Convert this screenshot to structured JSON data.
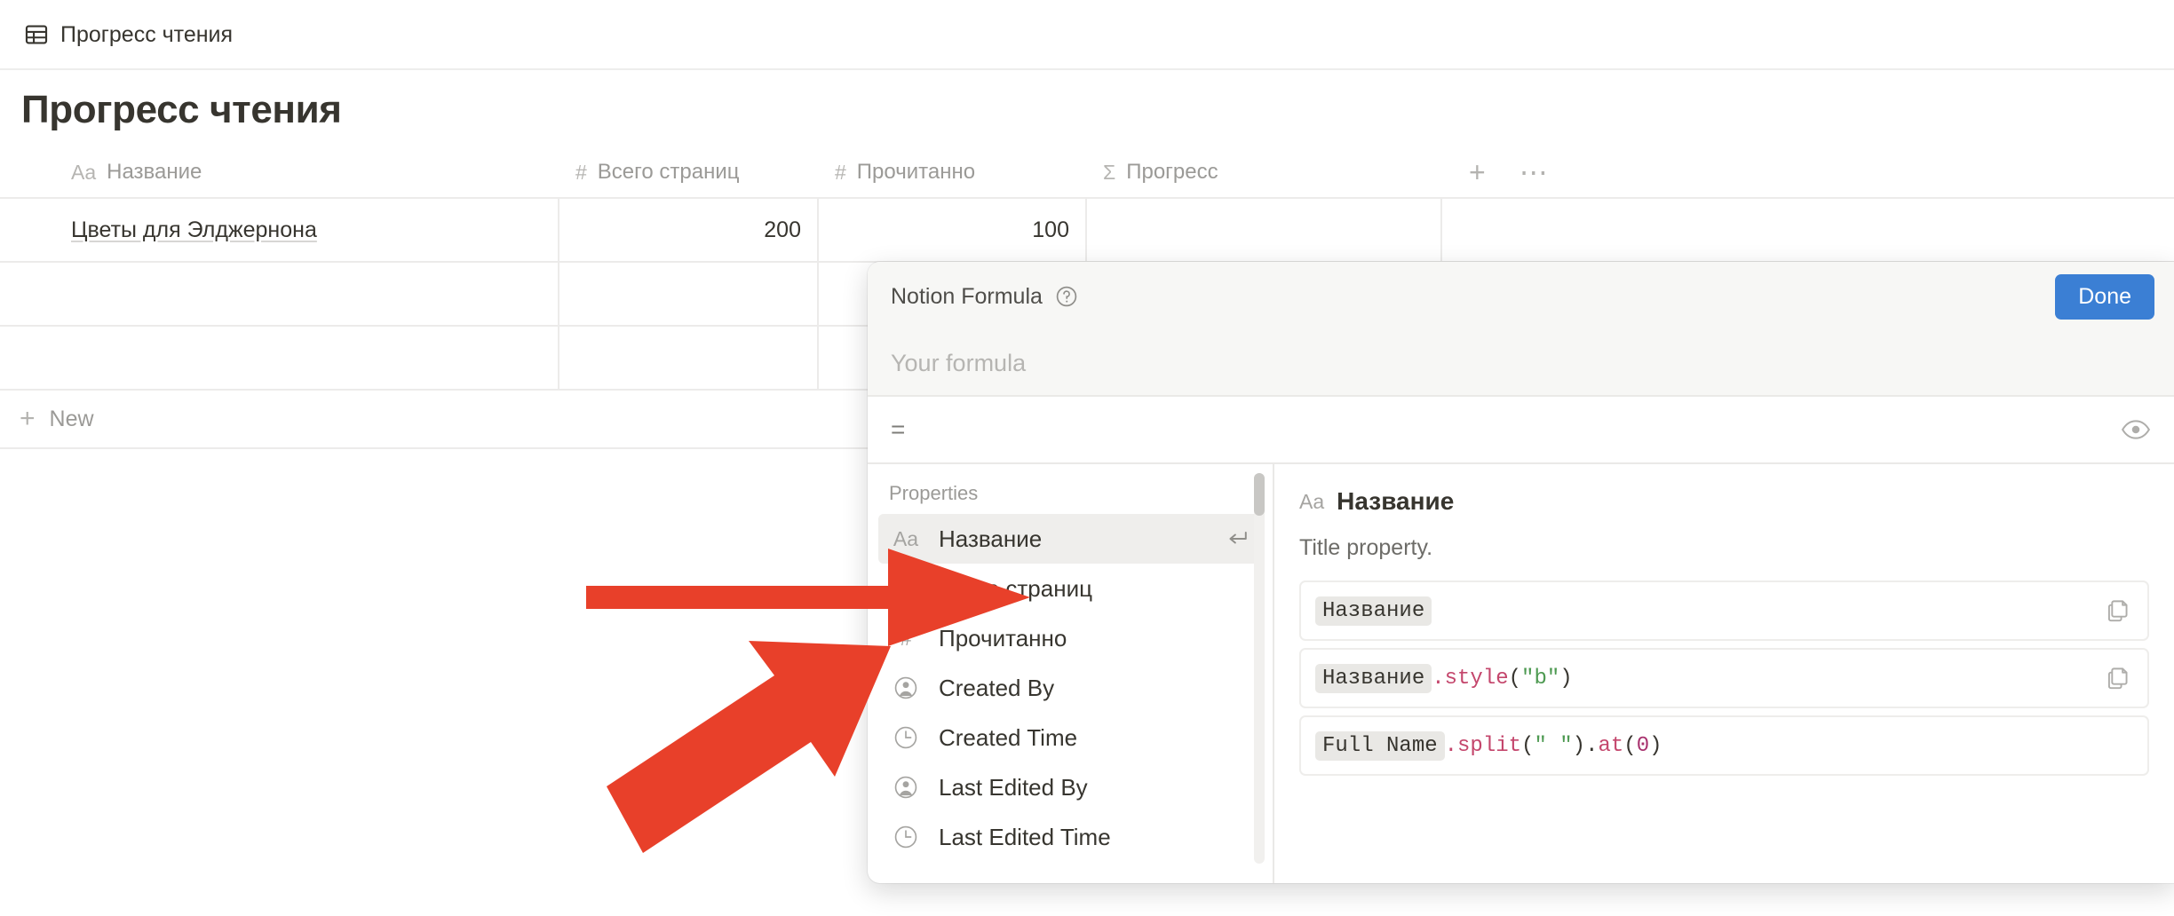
{
  "breadcrumb": {
    "icon": "table-grid-icon",
    "label": "Прогресс чтения"
  },
  "page": {
    "title": "Прогресс чтения"
  },
  "table": {
    "columns": [
      {
        "type_icon": "Aa",
        "label": "Название"
      },
      {
        "type_icon": "#",
        "label": "Всего страниц"
      },
      {
        "type_icon": "#",
        "label": "Прочитанно"
      },
      {
        "type_icon": "Σ",
        "label": "Прогресс"
      }
    ],
    "add_column_label": "+",
    "more_label": "⋯",
    "rows": [
      {
        "name": "Цветы для Элджернона",
        "total": "200",
        "read": "100",
        "progress": ""
      },
      {
        "name": "",
        "total": "",
        "read": "",
        "progress": ""
      },
      {
        "name": "",
        "total": "",
        "read": "",
        "progress": ""
      }
    ],
    "new_row_label": "New"
  },
  "dialog": {
    "title": "Notion Formula",
    "help_icon": "question-circle-icon",
    "done_label": "Done",
    "formula_placeholder": "Your formula",
    "formula_value": "",
    "equals_sign": "=",
    "preview_icon": "eye-icon",
    "properties_label": "Properties",
    "properties": [
      {
        "icon": "title-icon",
        "icon_glyph": "Aa",
        "label": "Название",
        "selected": true,
        "shortcut_icon": "return-icon"
      },
      {
        "icon": "number-icon",
        "icon_glyph": "#",
        "label": "Всего страниц",
        "selected": false
      },
      {
        "icon": "number-icon",
        "icon_glyph": "#",
        "label": "Прочитанно",
        "selected": false
      },
      {
        "icon": "person-icon",
        "icon_glyph": "",
        "label": "Created By",
        "selected": false
      },
      {
        "icon": "clock-icon",
        "icon_glyph": "",
        "label": "Created Time",
        "selected": false
      },
      {
        "icon": "person-icon",
        "icon_glyph": "",
        "label": "Last Edited By",
        "selected": false
      },
      {
        "icon": "clock-icon",
        "icon_glyph": "",
        "label": "Last Edited Time",
        "selected": false
      }
    ],
    "detail": {
      "type_glyph": "Aa",
      "title": "Название",
      "description": "Title property.",
      "examples": [
        {
          "tokens": [
            {
              "kind": "chip",
              "text": "Название"
            }
          ],
          "copyable": true
        },
        {
          "tokens": [
            {
              "kind": "chip",
              "text": "Название"
            },
            {
              "kind": "fn",
              "text": ".style"
            },
            {
              "kind": "punct",
              "text": "("
            },
            {
              "kind": "str",
              "text": "\"b\""
            },
            {
              "kind": "punct",
              "text": ")"
            }
          ],
          "copyable": true
        },
        {
          "tokens": [
            {
              "kind": "chip",
              "text": "Full Name"
            },
            {
              "kind": "fn",
              "text": ".split"
            },
            {
              "kind": "punct",
              "text": "("
            },
            {
              "kind": "str",
              "text": "\" \""
            },
            {
              "kind": "punct",
              "text": ")."
            },
            {
              "kind": "fn",
              "text": "at"
            },
            {
              "kind": "punct",
              "text": "("
            },
            {
              "kind": "num",
              "text": "0"
            },
            {
              "kind": "punct",
              "text": ")"
            }
          ],
          "copyable": false
        }
      ]
    }
  },
  "annotations": {
    "arrow_color": "#E8402A",
    "arrows": [
      {
        "name": "arrow-pointing-to-total-pages-property",
        "style": "horizontal"
      },
      {
        "name": "arrow-pointing-to-read-pages-property",
        "style": "diagonal"
      }
    ]
  }
}
